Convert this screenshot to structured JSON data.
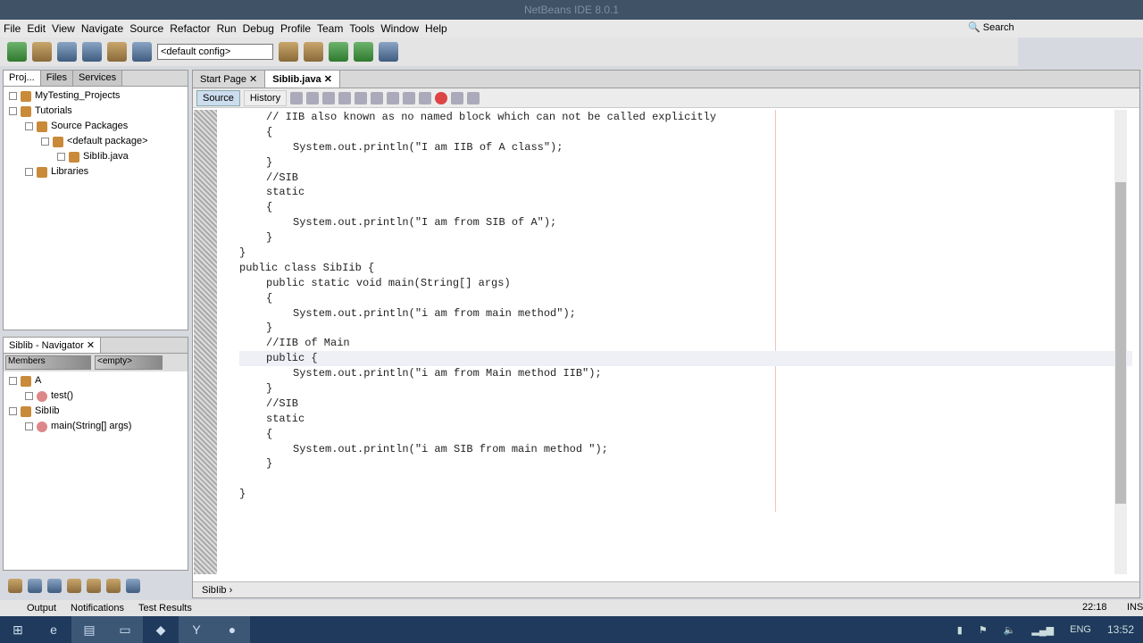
{
  "window": {
    "title": "NetBeans IDE 8.0.1"
  },
  "menu": [
    "File",
    "Edit",
    "View",
    "Navigate",
    "Source",
    "Refactor",
    "Run",
    "Debug",
    "Profile",
    "Team",
    "Tools",
    "Window",
    "Help"
  ],
  "toolbar": {
    "config": "<default config>",
    "search_placeholder": "Search"
  },
  "projects": {
    "tabs": [
      "Proj...",
      "Files",
      "Services"
    ],
    "tree": [
      {
        "label": "MyTesting_Projects",
        "depth": 0
      },
      {
        "label": "Tutorials",
        "depth": 0
      },
      {
        "label": "Source Packages",
        "depth": 1
      },
      {
        "label": "<default package>",
        "depth": 2
      },
      {
        "label": "SibIib.java",
        "depth": 3
      },
      {
        "label": "Libraries",
        "depth": 1
      }
    ]
  },
  "navigator": {
    "title": "Siblib - Navigator",
    "filter": "Members",
    "select": "<empty>",
    "tree": [
      {
        "label": "A",
        "depth": 0
      },
      {
        "label": "test()",
        "depth": 1
      },
      {
        "label": "SibIib",
        "depth": 0
      },
      {
        "label": "main(String[] args)",
        "depth": 1
      }
    ]
  },
  "editor": {
    "tabs": [
      "Start Page",
      "SibIib.java"
    ],
    "source_label": "Source",
    "history_label": "History",
    "lines": [
      {
        "i": 1,
        "t": "// IIB also known as no named block which can not be called explicitly"
      },
      {
        "i": 1,
        "t": "{"
      },
      {
        "i": 2,
        "t": "System.out.println(\"I am IIB of A class\");"
      },
      {
        "i": 1,
        "t": "}"
      },
      {
        "i": 1,
        "t": "//SIB"
      },
      {
        "i": 1,
        "t": "static"
      },
      {
        "i": 1,
        "t": "{"
      },
      {
        "i": 2,
        "t": "System.out.println(\"I am from SIB of A\");"
      },
      {
        "i": 1,
        "t": "}"
      },
      {
        "i": 0,
        "t": "}"
      },
      {
        "i": 0,
        "t": "public class SibIib {"
      },
      {
        "i": 1,
        "t": "public static void main(String[] args)"
      },
      {
        "i": 1,
        "t": "{"
      },
      {
        "i": 2,
        "t": "System.out.println(\"i am from main method\");"
      },
      {
        "i": 1,
        "t": "}"
      },
      {
        "i": 1,
        "t": "//IIB of Main"
      },
      {
        "i": 1,
        "t": "public {"
      },
      {
        "i": 2,
        "t": "System.out.println(\"i am from Main method IIB\");"
      },
      {
        "i": 1,
        "t": "}"
      },
      {
        "i": 1,
        "t": "//SIB"
      },
      {
        "i": 1,
        "t": "static"
      },
      {
        "i": 1,
        "t": "{"
      },
      {
        "i": 2,
        "t": "System.out.println(\"i am SIB from main method \");"
      },
      {
        "i": 1,
        "t": "}"
      },
      {
        "i": 0,
        "t": ""
      },
      {
        "i": 0,
        "t": "}"
      }
    ],
    "breadcrumb": "SibIib"
  },
  "bottom_tabs": [
    "Output",
    "Notifications",
    "Test Results"
  ],
  "status": {
    "position": "22:18",
    "mode": "INS"
  },
  "taskbar": {
    "lang": "ENG",
    "time": "13:52"
  }
}
